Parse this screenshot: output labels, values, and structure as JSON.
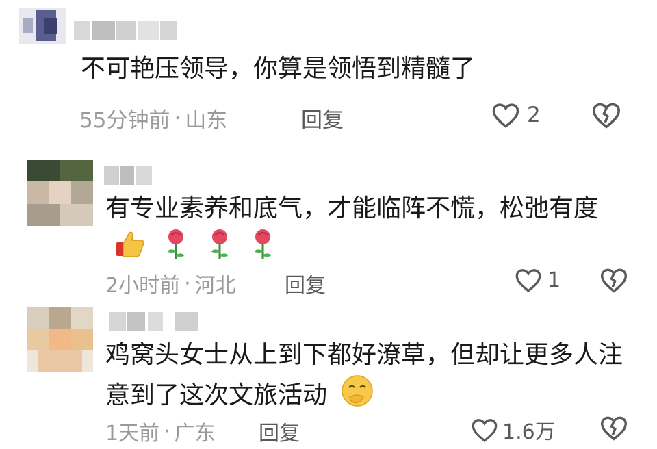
{
  "comments": [
    {
      "text": "不可艳压领导，你算是领悟到精髓了",
      "time": "55分钟前",
      "location": "山东",
      "reply_label": "回复",
      "likes": "2"
    },
    {
      "text": "有专业素养和底气，才能临阵不慌，松弛有度",
      "time": "2小时前",
      "location": "河北",
      "reply_label": "回复",
      "likes": "1",
      "emojis": [
        "thumbs-up",
        "rose",
        "rose",
        "rose"
      ]
    },
    {
      "text": "鸡窝头女士从上到下都好潦草，但却让更多人注意到了这次文旅活动",
      "time": "1天前",
      "location": "广东",
      "reply_label": "回复",
      "likes": "1.6万",
      "emojis": [
        "laugh-cover-face"
      ]
    }
  ],
  "separator": "·",
  "colors": {
    "meta_gray": "#9a9a9a",
    "action_gray": "#5a5a5a",
    "text": "#1a1a1a"
  }
}
